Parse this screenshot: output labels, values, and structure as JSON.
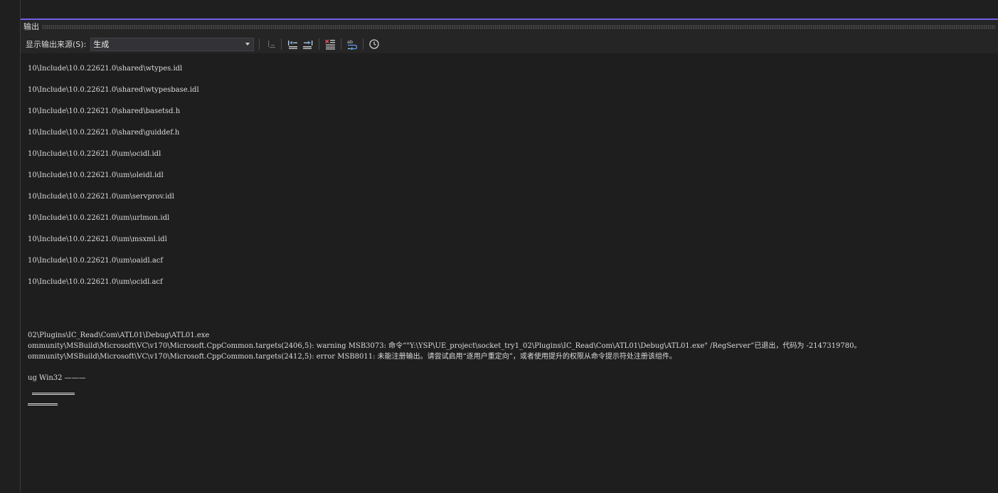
{
  "panel": {
    "title": "输出"
  },
  "toolbar": {
    "source_label": "显示输出来源(S):",
    "source_value": "生成",
    "icons": [
      "find-message-icon",
      "previous-message-icon",
      "next-message-icon",
      "clear-all-icon",
      "word-wrap-icon",
      "timestamp-icon"
    ]
  },
  "output": {
    "lines": [
      "10\\Include\\10.0.22621.0\\shared\\wtypes.idl",
      "",
      "10\\Include\\10.0.22621.0\\shared\\wtypesbase.idl",
      "",
      "10\\Include\\10.0.22621.0\\shared\\basetsd.h",
      "",
      "10\\Include\\10.0.22621.0\\shared\\guiddef.h",
      "",
      "10\\Include\\10.0.22621.0\\um\\ocidl.idl",
      "",
      "10\\Include\\10.0.22621.0\\um\\oleidl.idl",
      "",
      "10\\Include\\10.0.22621.0\\um\\servprov.idl",
      "",
      "10\\Include\\10.0.22621.0\\um\\urlmon.idl",
      "",
      "10\\Include\\10.0.22621.0\\um\\msxml.idl",
      "",
      "10\\Include\\10.0.22621.0\\um\\oaidl.acf",
      "",
      "10\\Include\\10.0.22621.0\\um\\ocidl.acf",
      "",
      "",
      "",
      "",
      "02\\Plugins\\IC_Read\\Com\\ATL01\\Debug\\ATL01.exe",
      "ommunity\\MSBuild\\Microsoft\\VC\\v170\\Microsoft.CppCommon.targets(2406,5): warning MSB3073: 命令“\"Y:\\YSP\\UE_project\\socket_try1_02\\Plugins\\IC_Read\\Com\\ATL01\\Debug\\ATL01.exe\" /RegServer”已退出，代码为 -2147319780。",
      "ommunity\\MSBuild\\Microsoft\\VC\\v170\\Microsoft.CppCommon.targets(2412,5): error MSB8011: 未能注册输出。请尝试启用“逐用户重定向”，或者使用提升的权限从命令提示符处注册该组件。",
      "",
      "ug Win32 ———"
    ]
  }
}
